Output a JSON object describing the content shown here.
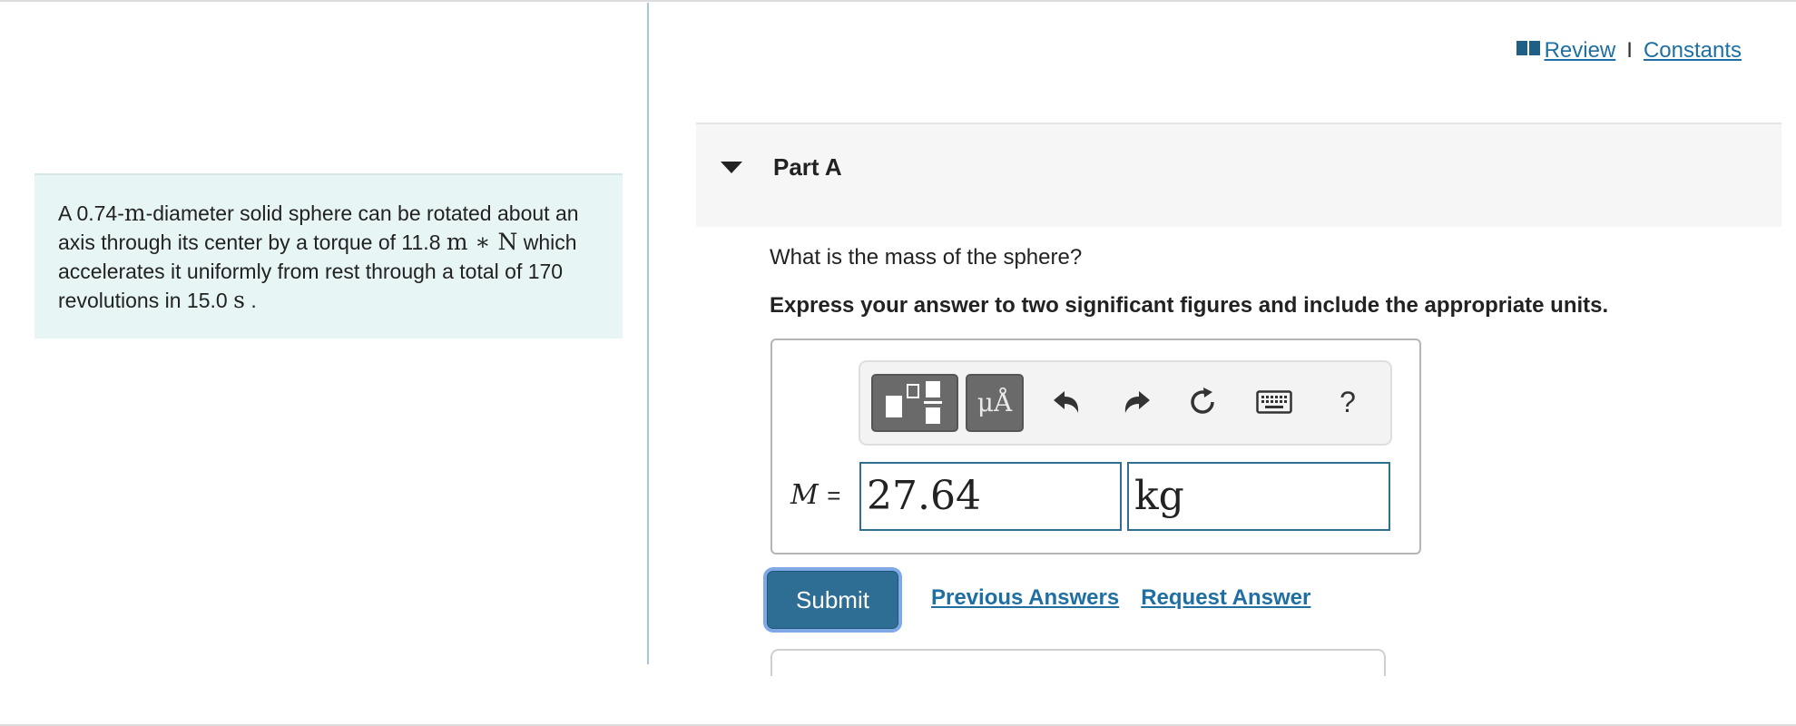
{
  "problem": {
    "text_prefix": "A 0.74-",
    "unit_m1": "m",
    "text_mid1": "-diameter solid sphere can be rotated about an axis through its center by a torque of 11.8",
    "unit_torque": "m ∗ N",
    "text_mid2": "which accelerates it uniformly from rest through a total of 170 revolutions in 15.0",
    "unit_s": "s",
    "text_end": "."
  },
  "top_links": {
    "review": "Review",
    "separator": "I",
    "constants": "Constants"
  },
  "part": {
    "title": "Part A"
  },
  "question": "What is the mass of the sphere?",
  "instruction": "Express your answer to two significant figures and include the appropriate units.",
  "toolbar": {
    "units_label": "μÅ",
    "help_label": "?"
  },
  "answer": {
    "variable": "M",
    "equals": "=",
    "value": "27.64",
    "unit": "kg"
  },
  "actions": {
    "submit": "Submit",
    "previous_answers": "Previous Answers",
    "request_answer": "Request Answer"
  },
  "colors": {
    "link": "#1f6fa3",
    "submit_bg": "#2f6e94",
    "problem_bg": "#e7f5f4"
  }
}
